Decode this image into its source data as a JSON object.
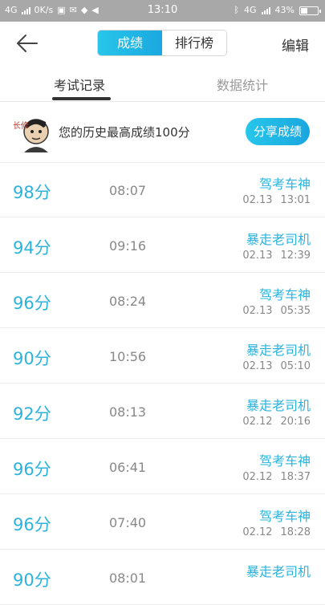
{
  "status_bar": {
    "net_left": "4G",
    "speed": "0K/s",
    "time": "13:10",
    "net_right": "4G",
    "battery": "43%",
    "battery_level": 0.43
  },
  "header": {
    "segment": [
      "成绩",
      "排行榜"
    ],
    "edit": "编辑"
  },
  "tabs": [
    "考试记录",
    "数据统计"
  ],
  "best": {
    "avatar_text": "长修",
    "text": "您的历史最高成绩100分",
    "share": "分享成绩"
  },
  "records": [
    {
      "score": "98分",
      "duration": "08:07",
      "title": "驾考车神",
      "date": "02.13",
      "time": "13:01"
    },
    {
      "score": "94分",
      "duration": "09:16",
      "title": "暴走老司机",
      "date": "02.13",
      "time": "12:39"
    },
    {
      "score": "96分",
      "duration": "08:24",
      "title": "驾考车神",
      "date": "02.13",
      "time": "05:35"
    },
    {
      "score": "90分",
      "duration": "10:56",
      "title": "暴走老司机",
      "date": "02.13",
      "time": "05:10"
    },
    {
      "score": "92分",
      "duration": "08:13",
      "title": "暴走老司机",
      "date": "02.12",
      "time": "20:16"
    },
    {
      "score": "96分",
      "duration": "06:41",
      "title": "驾考车神",
      "date": "02.12",
      "time": "18:37"
    },
    {
      "score": "96分",
      "duration": "07:40",
      "title": "驾考车神",
      "date": "02.12",
      "time": "18:28"
    },
    {
      "score": "90分",
      "duration": "08:01",
      "title": "暴走老司机",
      "date": "",
      "time": ""
    }
  ]
}
